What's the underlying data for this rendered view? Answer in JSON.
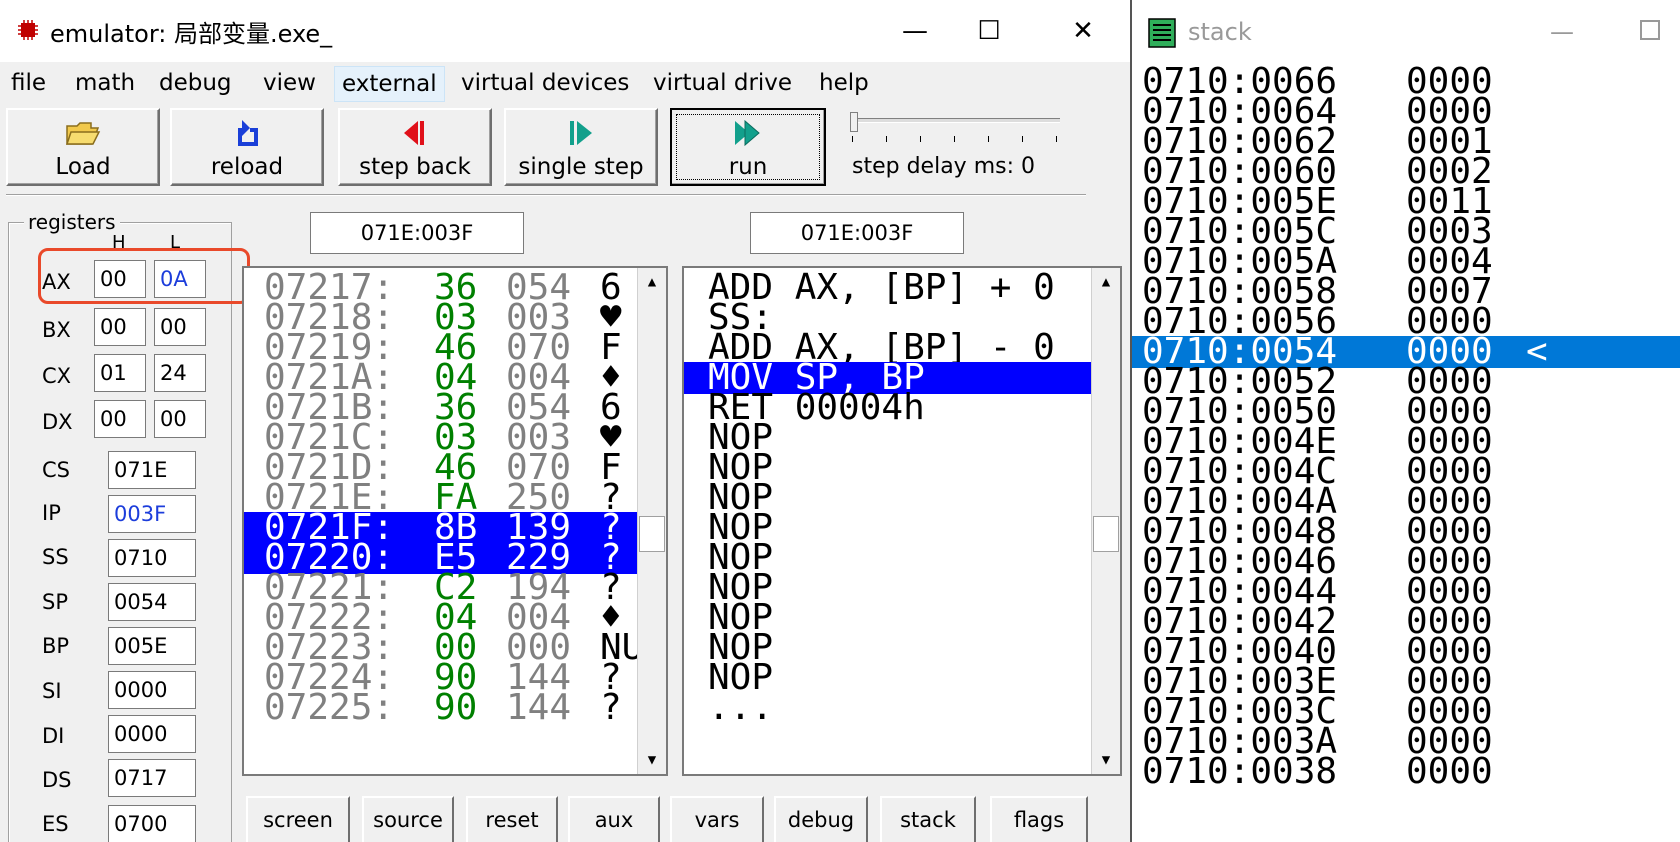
{
  "emulator": {
    "title": "emulator: 局部变量.exe_",
    "window_buttons": {
      "minimize": "—",
      "maximize": "☐",
      "close": "✕"
    },
    "menu": [
      "file",
      "math",
      "debug",
      "view",
      "external",
      "virtual devices",
      "virtual drive",
      "help"
    ],
    "menu_active": "external",
    "toolbar": {
      "load": "Load",
      "reload": "reload",
      "step_back": "step back",
      "single_step": "single step",
      "run": "run",
      "step_delay": "step delay ms: 0"
    },
    "registers": {
      "legend": "registers",
      "h_label": "H",
      "l_label": "L",
      "ax": {
        "name": "AX",
        "h": "00",
        "l": "0A"
      },
      "bx": {
        "name": "BX",
        "h": "00",
        "l": "00"
      },
      "cx": {
        "name": "CX",
        "h": "01",
        "l": "24"
      },
      "dx": {
        "name": "DX",
        "h": "00",
        "l": "00"
      },
      "cs": {
        "name": "CS",
        "value": "071E"
      },
      "ip": {
        "name": "IP",
        "value": "003F"
      },
      "ss": {
        "name": "SS",
        "value": "0710"
      },
      "sp": {
        "name": "SP",
        "value": "0054"
      },
      "bp": {
        "name": "BP",
        "value": "005E"
      },
      "si": {
        "name": "SI",
        "value": "0000"
      },
      "di": {
        "name": "DI",
        "value": "0000"
      },
      "ds": {
        "name": "DS",
        "value": "0717"
      },
      "es": {
        "name": "ES",
        "value": "0700"
      }
    },
    "memory_address": "071E:003F",
    "disasm_address": "071E:003F",
    "memory": [
      {
        "addr": "07217:",
        "hex": "36",
        "dec": "054",
        "chr": "6"
      },
      {
        "addr": "07218:",
        "hex": "03",
        "dec": "003",
        "chr": "♥"
      },
      {
        "addr": "07219:",
        "hex": "46",
        "dec": "070",
        "chr": "F"
      },
      {
        "addr": "0721A:",
        "hex": "04",
        "dec": "004",
        "chr": "♦"
      },
      {
        "addr": "0721B:",
        "hex": "36",
        "dec": "054",
        "chr": "6"
      },
      {
        "addr": "0721C:",
        "hex": "03",
        "dec": "003",
        "chr": "♥"
      },
      {
        "addr": "0721D:",
        "hex": "46",
        "dec": "070",
        "chr": "F"
      },
      {
        "addr": "0721E:",
        "hex": "FA",
        "dec": "250",
        "chr": "?"
      },
      {
        "addr": "0721F:",
        "hex": "8B",
        "dec": "139",
        "chr": "?",
        "selected": true
      },
      {
        "addr": "07220:",
        "hex": "E5",
        "dec": "229",
        "chr": "?",
        "selected": true
      },
      {
        "addr": "07221:",
        "hex": "C2",
        "dec": "194",
        "chr": "?"
      },
      {
        "addr": "07222:",
        "hex": "04",
        "dec": "004",
        "chr": "♦"
      },
      {
        "addr": "07223:",
        "hex": "00",
        "dec": "000",
        "chr": "NU"
      },
      {
        "addr": "07224:",
        "hex": "90",
        "dec": "144",
        "chr": "?"
      },
      {
        "addr": "07225:",
        "hex": "90",
        "dec": "144",
        "chr": "?"
      }
    ],
    "disasm": [
      {
        "text": "ADD AX, [BP] + 0"
      },
      {
        "text": "SS:"
      },
      {
        "text": "ADD AX, [BP] - 0"
      },
      {
        "text": "MOV SP, BP",
        "selected": true
      },
      {
        "text": "RET 00004h"
      },
      {
        "text": "NOP"
      },
      {
        "text": "NOP"
      },
      {
        "text": "NOP"
      },
      {
        "text": "NOP"
      },
      {
        "text": "NOP"
      },
      {
        "text": "NOP"
      },
      {
        "text": "NOP"
      },
      {
        "text": "NOP"
      },
      {
        "text": "NOP"
      },
      {
        "text": "..."
      }
    ],
    "bottom_buttons": [
      "screen",
      "source",
      "reset",
      "aux",
      "vars",
      "debug",
      "stack",
      "flags"
    ]
  },
  "stack": {
    "title": "stack",
    "window_buttons": {
      "minimize": "—"
    },
    "rows": [
      {
        "addr": "0710:0066",
        "val": "0000"
      },
      {
        "addr": "0710:0064",
        "val": "0000"
      },
      {
        "addr": "0710:0062",
        "val": "0001"
      },
      {
        "addr": "0710:0060",
        "val": "0002"
      },
      {
        "addr": "0710:005E",
        "val": "0011"
      },
      {
        "addr": "0710:005C",
        "val": "0003"
      },
      {
        "addr": "0710:005A",
        "val": "0004"
      },
      {
        "addr": "0710:0058",
        "val": "0007"
      },
      {
        "addr": "0710:0056",
        "val": "0000"
      },
      {
        "addr": "0710:0054",
        "val": "0000",
        "mark": "<",
        "selected": true
      },
      {
        "addr": "0710:0052",
        "val": "0000"
      },
      {
        "addr": "0710:0050",
        "val": "0000"
      },
      {
        "addr": "0710:004E",
        "val": "0000"
      },
      {
        "addr": "0710:004C",
        "val": "0000"
      },
      {
        "addr": "0710:004A",
        "val": "0000"
      },
      {
        "addr": "0710:0048",
        "val": "0000"
      },
      {
        "addr": "0710:0046",
        "val": "0000"
      },
      {
        "addr": "0710:0044",
        "val": "0000"
      },
      {
        "addr": "0710:0042",
        "val": "0000"
      },
      {
        "addr": "0710:0040",
        "val": "0000"
      },
      {
        "addr": "0710:003E",
        "val": "0000"
      },
      {
        "addr": "0710:003C",
        "val": "0000"
      },
      {
        "addr": "0710:003A",
        "val": "0000"
      },
      {
        "addr": "0710:0038",
        "val": "0000"
      }
    ]
  },
  "colors": {
    "selection_blue": "#0000ff",
    "stack_selection": "#0078d7",
    "hex_green": "#008000",
    "highlight_red": "#e9492a",
    "changed_register": "#1c3ddb"
  }
}
